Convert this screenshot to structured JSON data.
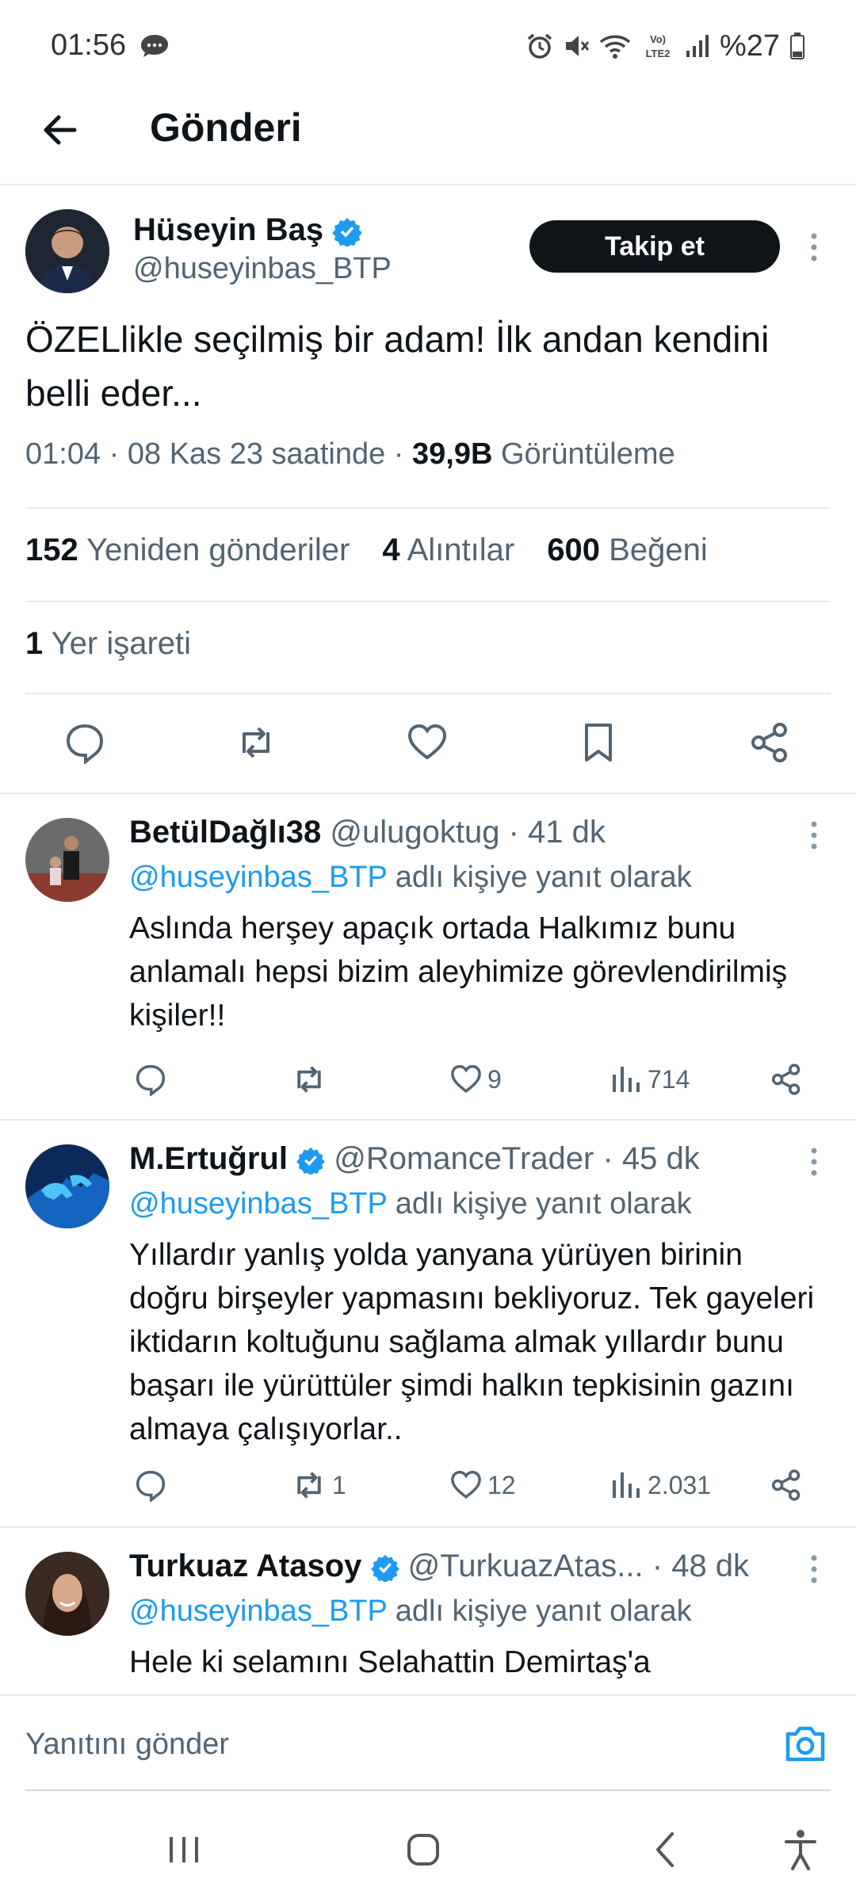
{
  "status_bar": {
    "time": "01:56",
    "battery": "%27",
    "network": "VoLTE2"
  },
  "header": {
    "title": "Gönderi"
  },
  "post": {
    "author_name": "Hüseyin Baş",
    "author_handle": "@huseyinbas_BTP",
    "follow_label": "Takip et",
    "text": "ÖZELlikle seçilmiş bir adam! İlk andan kendini belli eder...",
    "time_date": "01:04 · 08 Kas 23 saatinde ·",
    "views_count": "39,9B",
    "views_label": "Görüntüleme",
    "reposts_count": "152",
    "reposts_label": "Yeniden gönderiler",
    "quotes_count": "4",
    "quotes_label": "Alıntılar",
    "likes_count": "600",
    "likes_label": "Beğeni",
    "bookmarks_count": "1",
    "bookmarks_label": "Yer işareti"
  },
  "replies": [
    {
      "name": "BetülDağlı38",
      "verified": false,
      "handle": "@ulugoktug · 41 dk",
      "reply_to_mention": "@huseyinbas_BTP",
      "reply_to_suffix": "adlı kişiye yanıt olarak",
      "text": "Aslında herşey apaçık ortada  Halkımız bunu anlamalı hepsi bizim aleyhimize görevlendirilmiş kişiler!!",
      "reposts": "",
      "likes": "9",
      "views": "714"
    },
    {
      "name": "M.Ertuğrul",
      "verified": true,
      "handle": "@RomanceTrader · 45 dk",
      "reply_to_mention": "@huseyinbas_BTP",
      "reply_to_suffix": "adlı kişiye yanıt olarak",
      "text": "Yıllardır yanlış yolda yanyana yürüyen birinin doğru birşeyler yapmasını bekliyoruz. Tek gayeleri iktidarın koltuğunu sağlama almak yıllardır bunu başarı ile yürüttüler şimdi halkın tepkisinin gazını almaya çalışıyorlar..",
      "reposts": "1",
      "likes": "12",
      "views": "2.031"
    },
    {
      "name": "Turkuaz Atasoy",
      "verified": true,
      "handle": "@TurkuazAtas... · 48 dk",
      "reply_to_mention": "@huseyinbas_BTP",
      "reply_to_suffix": "adlı kişiye yanıt olarak",
      "text": "Hele ki selamını Selahattin Demirtaş'a"
    }
  ],
  "composer": {
    "placeholder": "Yanıtını gönder"
  },
  "colors": {
    "accent": "#1d9bf0",
    "text": "#0f1419",
    "muted": "#536471",
    "divider": "#e6e9eb"
  }
}
